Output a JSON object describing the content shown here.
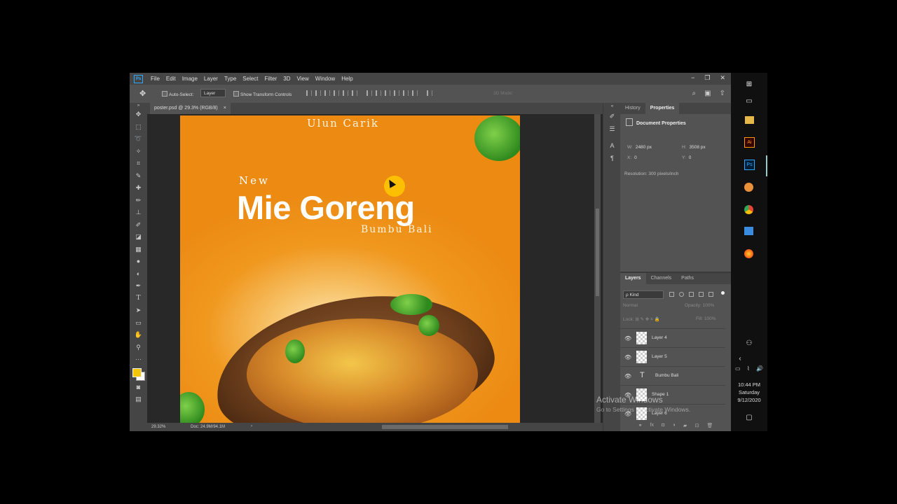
{
  "app": {
    "logo": "Ps",
    "menus": [
      "File",
      "Edit",
      "Image",
      "Layer",
      "Type",
      "Select",
      "Filter",
      "3D",
      "View",
      "Window",
      "Help"
    ],
    "window_controls": [
      "−",
      "❐",
      "✕"
    ]
  },
  "options_bar": {
    "move_icon": "✥",
    "auto_select_label": "Auto-Select:",
    "auto_select_value": "Layer",
    "transform_label": "Show Transform Controls",
    "mode_3d": "3D Mode:"
  },
  "document_tab": {
    "title": "poster.psd @ 29.3% (RGB/8)",
    "close": "×"
  },
  "poster": {
    "brand": "Ulun Carik",
    "tagline": "New",
    "title": "Mie Goreng",
    "subtitle": "Bumbu Bali"
  },
  "status": {
    "zoom": "29.32%",
    "doc": "Doc: 24.9M/94.1M",
    "arrow": "›"
  },
  "properties": {
    "tabs": [
      "History",
      "Properties"
    ],
    "active_tab": "Properties",
    "header": "Document Properties",
    "w_label": "W:",
    "w": "2480 px",
    "h_label": "H:",
    "h": "3508 px",
    "x_label": "X:",
    "x": "0",
    "y_label": "Y:",
    "y": "0",
    "resolution": "Resolution: 300 pixels/inch"
  },
  "layers_panel": {
    "tabs": [
      "Layers",
      "Channels",
      "Paths"
    ],
    "active_tab": "Layers",
    "kind": "ρ Kind",
    "blend_mode": "Normal",
    "opacity_label": "Opacity:",
    "opacity": "100%",
    "lock_label": "Lock:",
    "fill_label": "Fill:",
    "fill": "100%",
    "layers": [
      {
        "name": "Layer 4",
        "type": "image"
      },
      {
        "name": "Layer 5",
        "type": "image"
      },
      {
        "name": "Bumbu Bali",
        "type": "text"
      },
      {
        "name": "Shape 1",
        "type": "shape"
      },
      {
        "name": "Layer 6",
        "type": "image"
      }
    ],
    "footer_icons": [
      "link-icon",
      "fx-icon",
      "mask-icon",
      "adjustment-icon",
      "group-icon",
      "new-layer-icon",
      "trash-icon"
    ]
  },
  "watermark": {
    "title": "Activate Windows",
    "text": "Go to Settings to activate Windows."
  },
  "taskbar": {
    "time": "10:44 PM",
    "day": "Saturday",
    "date": "9/12/2020",
    "apps": [
      "windows-logo-icon",
      "task-view-icon",
      "file-explorer-icon",
      "illustrator-icon",
      "photoshop-icon",
      "app-icon",
      "chrome-icon",
      "media-player-icon",
      "firefox-icon"
    ]
  },
  "colors": {
    "accent": "#31a8ff",
    "foreground": "#f2c40a",
    "background": "#ffffff",
    "poster_orange": "#ec8a12"
  }
}
